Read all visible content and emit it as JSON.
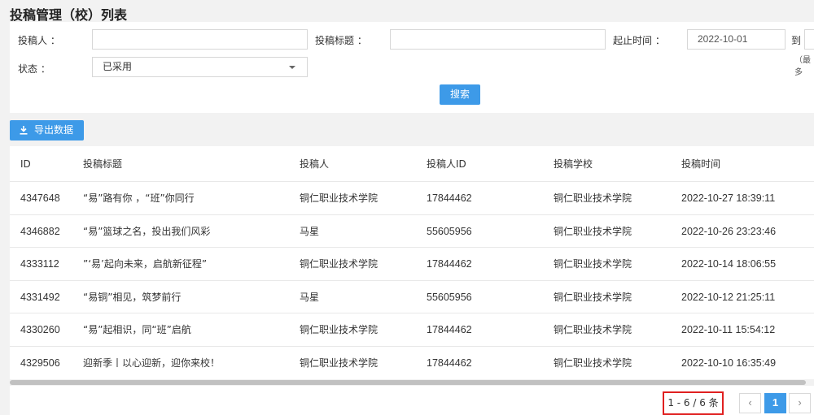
{
  "page": {
    "title": "投稿管理（校）列表"
  },
  "filters": {
    "submitter_label": "投稿人 ：",
    "submitter_value": "",
    "title_label": "投稿标题 ：",
    "title_value": "",
    "time_label": "起止时间 ：",
    "start_date": "2022-10-01",
    "to_label": "到",
    "end_hint": "（最多",
    "status_label": "状态 ：",
    "status_value": "已采用",
    "search_button": "搜索"
  },
  "toolbar": {
    "export_button": "导出数据",
    "export_icon": "download-icon"
  },
  "table": {
    "headers": [
      "ID",
      "投稿标题",
      "投稿人",
      "投稿人ID",
      "投稿学校",
      "投稿时间"
    ],
    "rows": [
      [
        "4347648",
        "“易”路有你 ，“班”你同行",
        "铜仁职业技术学院",
        "17844462",
        "铜仁职业技术学院",
        "2022-10-27 18:39:11"
      ],
      [
        "4346882",
        "“易”篮球之名，投出我们风彩",
        "马星",
        "55605956",
        "铜仁职业技术学院",
        "2022-10-26 23:23:46"
      ],
      [
        "4333112",
        "”‘易’起向未来，启航新征程”",
        "铜仁职业技术学院",
        "17844462",
        "铜仁职业技术学院",
        "2022-10-14 18:06:55"
      ],
      [
        "4331492",
        "“易铜”相见，筑梦前行",
        "马星",
        "55605956",
        "铜仁职业技术学院",
        "2022-10-12 21:25:11"
      ],
      [
        "4330260",
        "“易”起相识，同“班”启航",
        "铜仁职业技术学院",
        "17844462",
        "铜仁职业技术学院",
        "2022-10-11 15:54:12"
      ],
      [
        "4329506",
        "迎新季丨以心迎新，迎你来校！",
        "铜仁职业技术学院",
        "17844462",
        "铜仁职业技术学院",
        "2022-10-10 16:35:49"
      ]
    ]
  },
  "pagination": {
    "summary": "1 - 6 / 6 条",
    "prev": "‹",
    "current": "1",
    "next": "›"
  },
  "colors": {
    "primary": "#3d9ae8",
    "highlight_border": "#e02020"
  }
}
